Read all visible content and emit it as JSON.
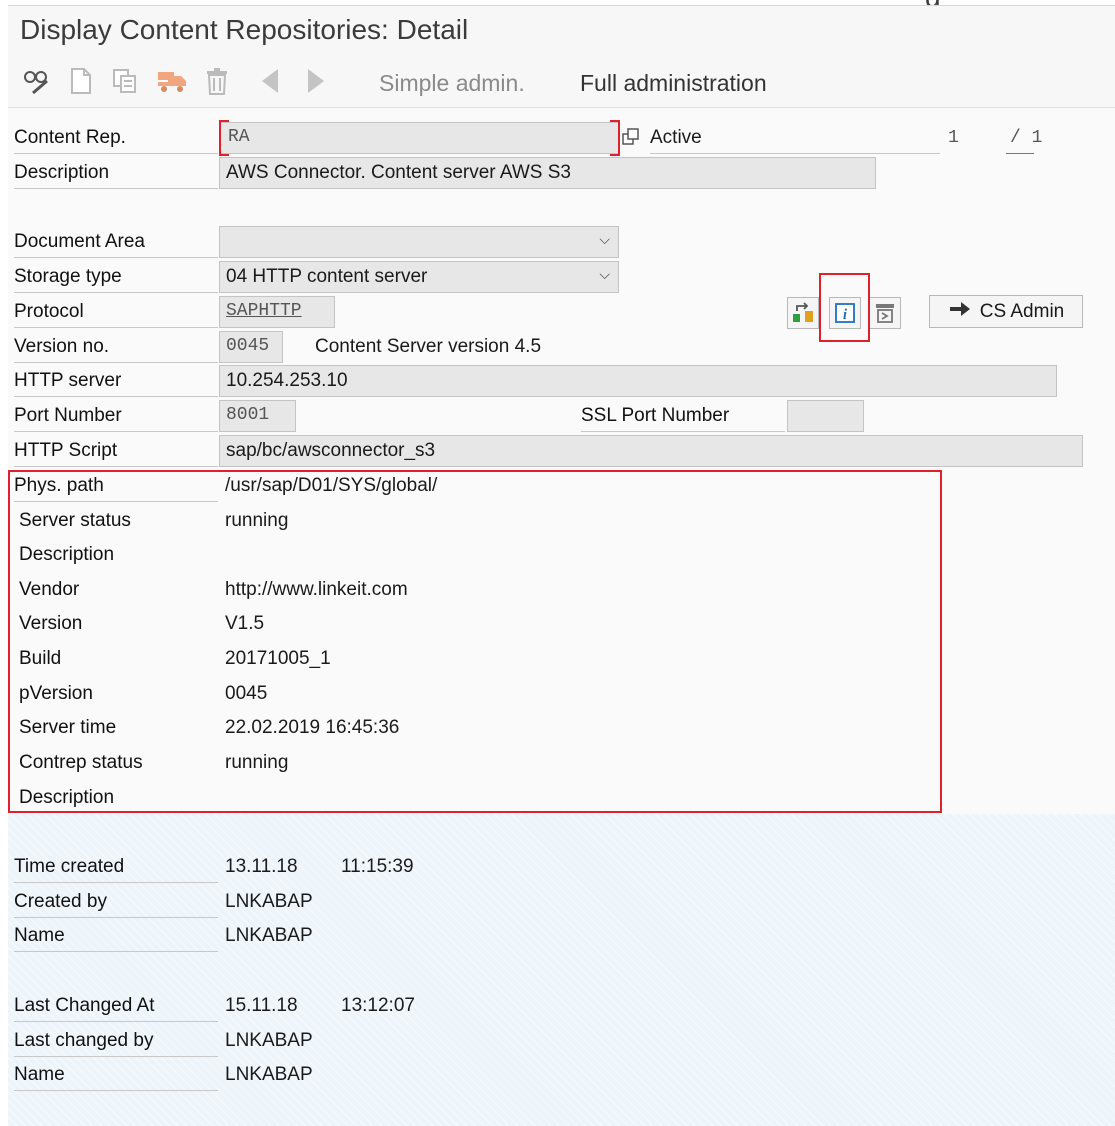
{
  "title": "Display Content Repositories: Detail",
  "cutoff_char": "g",
  "toolbar": {
    "simple_admin": "Simple admin.",
    "full_admin": "Full administration"
  },
  "header": {
    "content_rep_label": "Content Rep.",
    "content_rep_value": "RA",
    "active_label": "Active",
    "page_current": "1",
    "page_total": "/ 1"
  },
  "fields": {
    "description_label": "Description",
    "description_value": "AWS Connector. Content server AWS S3",
    "document_area_label": "Document Area",
    "document_area_value": "",
    "storage_type_label": "Storage type",
    "storage_type_value": "04 HTTP content server",
    "protocol_label": "Protocol",
    "protocol_value": "SAPHTTP",
    "cs_admin_label": "CS Admin",
    "version_no_label": "Version no.",
    "version_no_value": "0045",
    "cs_version_text": "Content Server version 4.5",
    "http_server_label": "HTTP server",
    "http_server_value": "10.254.253.10",
    "port_label": "Port Number",
    "port_value": "8001",
    "ssl_port_label": "SSL Port Number",
    "ssl_port_value": "",
    "http_script_label": "HTTP Script",
    "http_script_value": "sap/bc/awsconnector_s3"
  },
  "status": {
    "phys_path_label": "Phys. path",
    "phys_path_value": "/usr/sap/D01/SYS/global/",
    "rows": [
      {
        "label": "Server status",
        "value": "running"
      },
      {
        "label": "Description",
        "value": ""
      },
      {
        "label": "Vendor",
        "value": "http://www.linkeit.com"
      },
      {
        "label": "Version",
        "value": "V1.5"
      },
      {
        "label": "Build",
        "value": "20171005_1"
      },
      {
        "label": "pVersion",
        "value": "0045"
      },
      {
        "label": "Server time",
        "value": "22.02.2019 16:45:36"
      },
      {
        "label": "Contrep status",
        "value": "running"
      },
      {
        "label": "Description",
        "value": ""
      }
    ]
  },
  "created": {
    "time_label": "Time created",
    "date": "13.11.18",
    "time": "11:15:39",
    "by_label": "Created by",
    "by_value": "LNKABAP",
    "name_label": "Name",
    "name_value": "LNKABAP"
  },
  "changed": {
    "time_label": "Last Changed At",
    "date": "15.11.18",
    "time": "13:12:07",
    "by_label": "Last changed by",
    "by_value": "LNKABAP",
    "name_label": "Name",
    "name_value": "LNKABAP"
  },
  "icons": [
    "glasses-pencil-icon",
    "new-document-icon",
    "copy-icon",
    "transport-truck-icon",
    "trash-icon",
    "back-arrow-icon",
    "forward-arrow-icon",
    "transfer-icon",
    "info-icon",
    "export-icon",
    "arrow-right-icon"
  ],
  "colors": {
    "highlight": "#e0202c",
    "info_icon": "#1f6fc5"
  }
}
